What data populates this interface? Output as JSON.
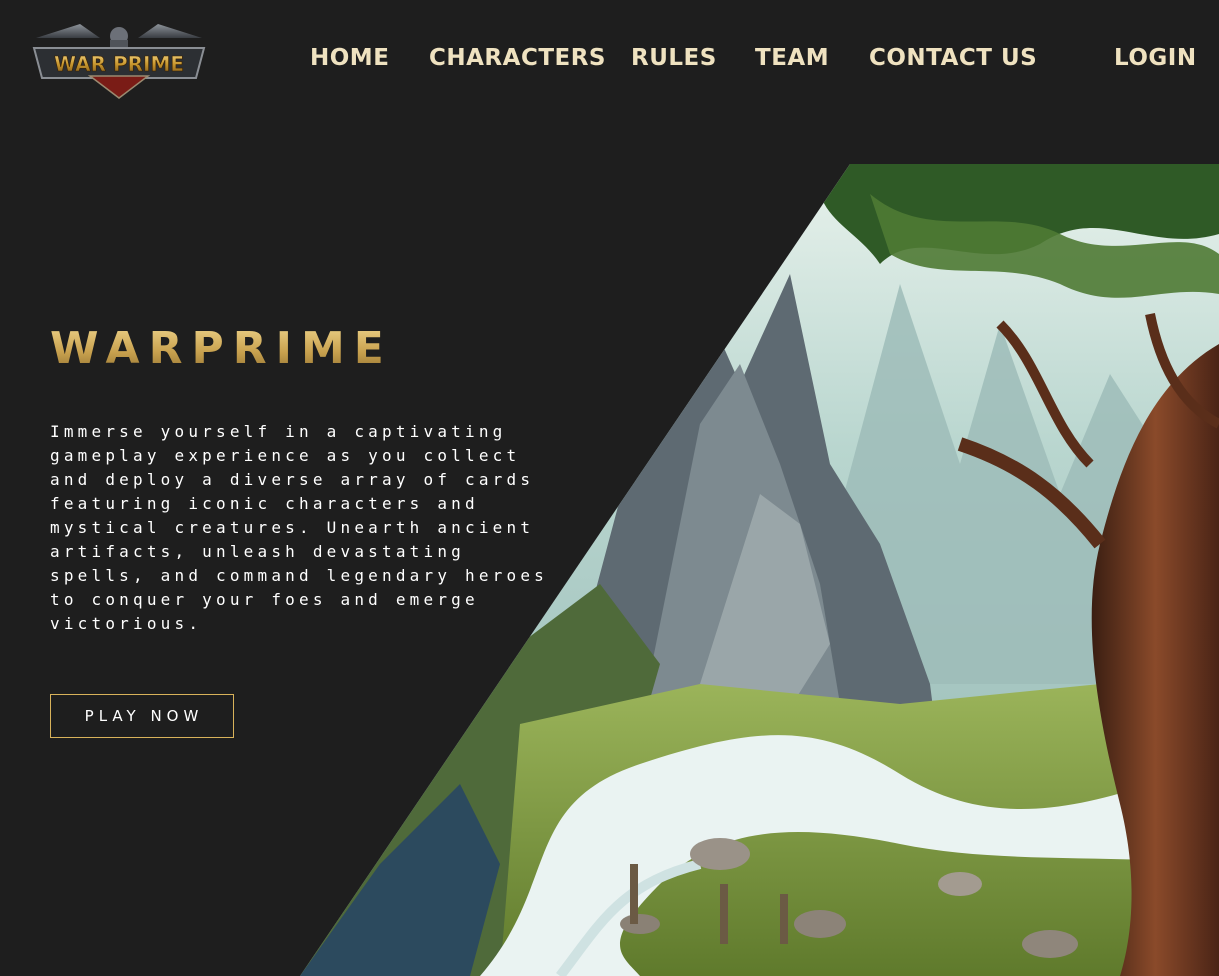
{
  "brand": {
    "logo_text": "WAR PRIME"
  },
  "nav": {
    "home": "HOME",
    "characters": "CHARACTERS",
    "rules": "RULES",
    "team": "TEAM",
    "contact": "CONTACT US",
    "login": "LOGIN"
  },
  "hero": {
    "title": "WARPRIME",
    "description": "Immerse yourself in a captivating gameplay experience as you collect and deploy a diverse array of cards featuring iconic characters and mystical creatures. Unearth ancient artifacts, unleash devastating spells, and command legendary heroes to conquer your foes and emerge victorious.",
    "cta_label": "PLAY NOW"
  },
  "colors": {
    "background": "#1e1e1e",
    "nav_text": "#efe2c0",
    "gold": "#d8b25a",
    "text": "#ffffff"
  }
}
